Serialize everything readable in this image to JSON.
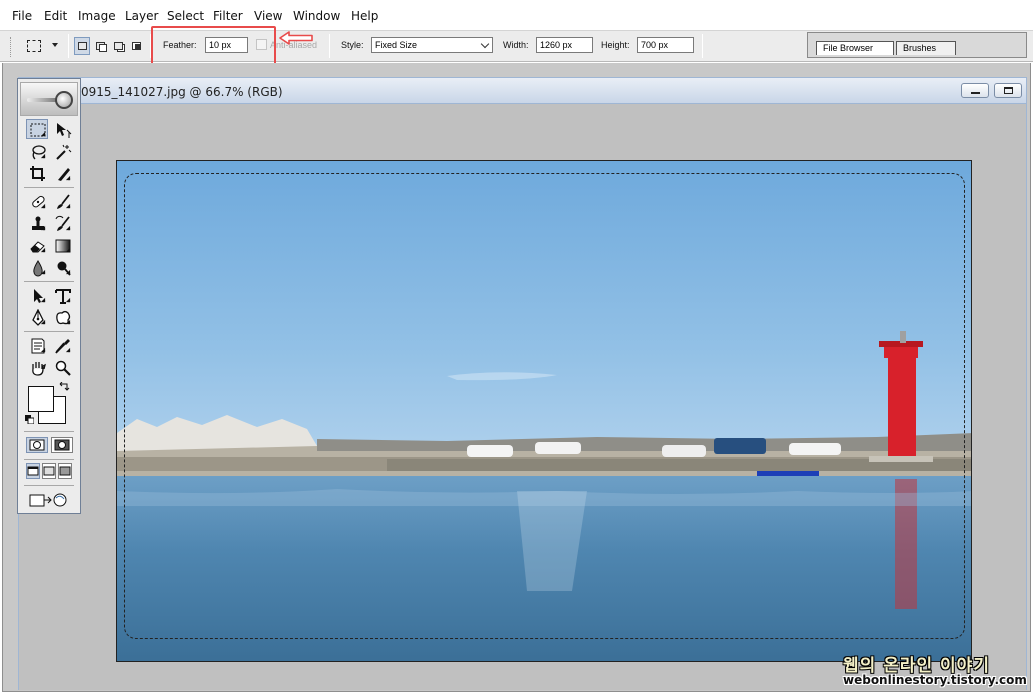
{
  "menu": [
    "File",
    "Edit",
    "Image",
    "Layer",
    "Select",
    "Filter",
    "View",
    "Window",
    "Help"
  ],
  "options": {
    "feather_label": "Feather:",
    "feather_value": "10 px",
    "antialiased_label": "Anti-aliased",
    "style_label": "Style:",
    "style_value": "Fixed Size",
    "width_label": "Width:",
    "width_value": "1260 px",
    "height_label": "Height:",
    "height_value": "700 px"
  },
  "palette_well": {
    "tabs": [
      "File Browser",
      "Brushes"
    ]
  },
  "document": {
    "title": "0915_141027.jpg @ 66.7% (RGB)"
  },
  "watermark": {
    "korean": "웹의 온라인 이야기",
    "url": "webonlinestory.tistory.com"
  },
  "colors": {
    "highlight": "#e84b4b",
    "sky": "#7fb2de",
    "sea": "#4f86b0",
    "lighthouse": "#d8212b"
  },
  "icons": {
    "tools": [
      "marquee-icon",
      "move-icon",
      "lasso-icon",
      "magic-wand-icon",
      "crop-icon",
      "slice-icon",
      "healing-brush-icon",
      "brush-icon",
      "clone-stamp-icon",
      "history-brush-icon",
      "eraser-icon",
      "gradient-icon",
      "blur-icon",
      "dodge-icon",
      "path-select-icon",
      "type-icon",
      "pen-icon",
      "custom-shape-icon",
      "notes-icon",
      "eyedropper-icon",
      "hand-icon",
      "zoom-icon"
    ]
  }
}
